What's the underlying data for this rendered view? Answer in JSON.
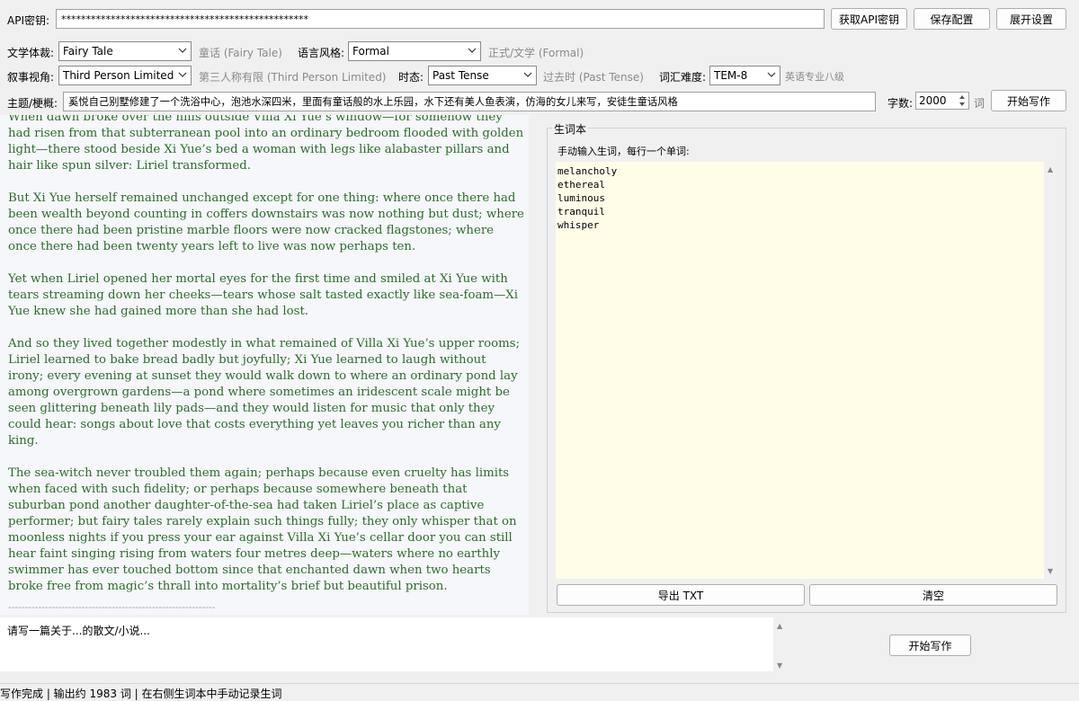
{
  "top": {
    "api_label": "API密钥:",
    "api_value": "**************************************************",
    "get_api_button": "获取API密钥",
    "save_config_button": "保存配置",
    "expand_settings_button": "展开设置"
  },
  "settings": {
    "genre_label": "文学体裁:",
    "genre_value": "Fairy Tale",
    "genre_hint": "童话 (Fairy Tale)",
    "style_label": "语言风格:",
    "style_value": "Formal",
    "style_hint": "正式/文学 (Formal)",
    "pov_label": "叙事视角:",
    "pov_value": "Third Person Limited",
    "pov_hint": "第三人称有限 (Third Person Limited)",
    "tense_label": "时态:",
    "tense_value": "Past Tense",
    "tense_hint": "过去时 (Past Tense)",
    "vocab_level_label": "词汇难度:",
    "vocab_level_value": "TEM-8",
    "vocab_level_hint": "英语专业八级",
    "topic_label": "主题/梗概:",
    "topic_value": "奚悦自己别墅修建了一个洗浴中心，泡池水深四米，里面有童话般的水上乐园，水下还有美人鱼表演，仿海的女儿来写，安徒生童话风格",
    "word_count_label": "字数:",
    "word_count_value": "2000",
    "word_unit": "词",
    "start_writing_button": "开始写作"
  },
  "story": {
    "paragraphs": [
      "When dawn broke over the hills outside Villa Xi Yue’s window—for somehow they had risen from that subterranean pool into an ordinary bedroom flooded with golden light—there stood beside Xi Yue’s bed a woman with legs like alabaster pillars and hair like spun silver: Liriel transformed.",
      "But Xi Yue herself remained unchanged except for one thing: where once there had been wealth beyond counting in coffers downstairs was now nothing but dust; where once there had been pristine marble floors were now cracked flagstones; where once there had been twenty years left to live was now perhaps ten.",
      "Yet when Liriel opened her mortal eyes for the first time and smiled at Xi Yue with tears streaming down her cheeks—tears whose salt tasted exactly like sea-foam—Xi Yue knew she had gained more than she had lost.",
      "And so they lived together modestly in what remained of Villa Xi Yue’s upper rooms; Liriel learned to bake bread badly but joyfully; Xi Yue learned to laugh without irony; every evening at sunset they would walk down to where an ordinary pond lay among overgrown gardens—a pond where sometimes an iridescent scale might be seen glittering beneath lily pads—and they would listen for music that only they could hear: songs about love that costs everything yet leaves you richer than any king.",
      "The sea-witch never troubled them again; perhaps because even cruelty has limits when faced with such fidelity; or perhaps because somewhere beneath that suburban pond another daughter-of-the-sea had taken Liriel’s place as captive performer; but fairy tales rarely explain such things fully; they only whisper that on moonless nights if you press your ear against Villa Xi Yue’s cellar door you can still hear faint singing rising from waters four metres deep—waters where no earthly swimmer has ever touched bottom since that enchanted dawn when two hearts broke free from magic’s thrall into mortality’s brief but beautiful prison."
    ],
    "separator": "--------------------------------------------------------------"
  },
  "vocab": {
    "group_title": "生词本",
    "instruction": "手动输入生词，每行一个单词:",
    "words": [
      "melancholy",
      "ethereal",
      "luminous",
      "tranquil",
      "whisper"
    ],
    "export_button": "导出 TXT",
    "clear_button": "清空"
  },
  "prompt": {
    "placeholder": "请写一篇关于...的散文/小说...",
    "start_button": "开始写作"
  },
  "status": {
    "text": "写作完成 | 输出约 1983 词 | 在右侧生词本中手动记录生词"
  }
}
